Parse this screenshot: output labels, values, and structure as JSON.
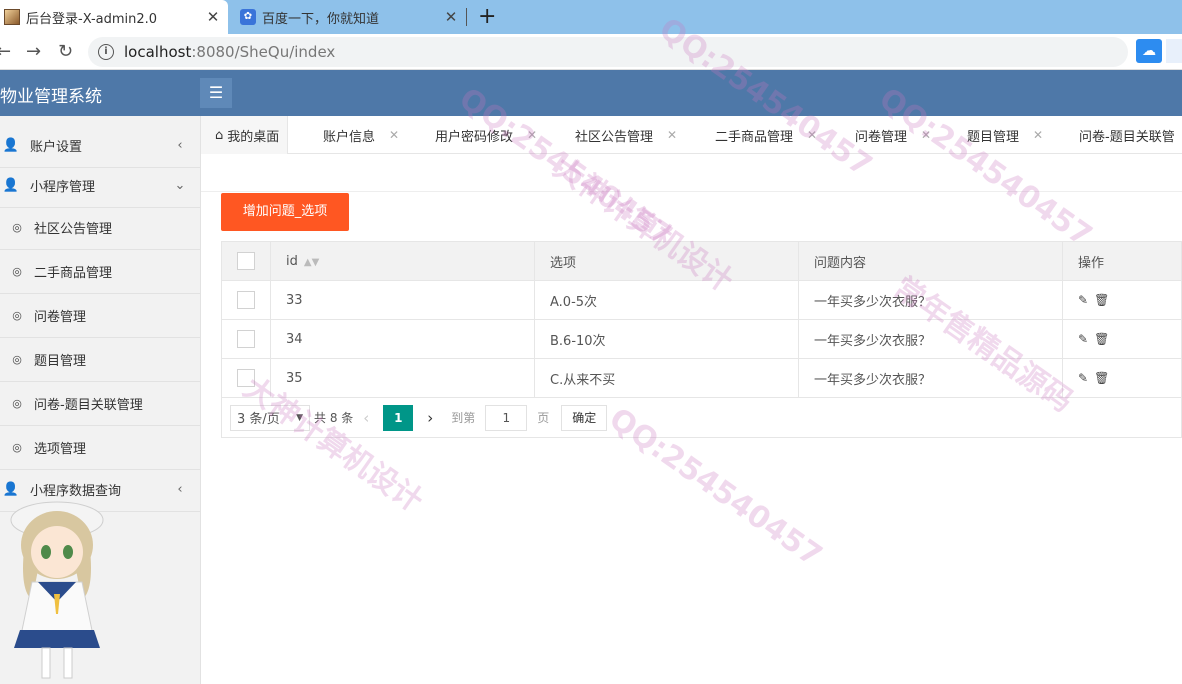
{
  "browser": {
    "tabs": [
      {
        "title": "后台登录-X-admin2.0",
        "active": true
      },
      {
        "title": "百度一下，你就知道",
        "active": false
      }
    ],
    "url_host": "localhost",
    "url_path": ":8080/SheQu/index"
  },
  "app": {
    "title": "物业管理系统",
    "menu_toggle_icon": "menu-icon"
  },
  "sidebar": {
    "items": [
      {
        "label": "账户设置",
        "arrow": "<",
        "type": "top"
      },
      {
        "label": "小程序管理",
        "arrow": "∨",
        "type": "top"
      },
      {
        "label": "社区公告管理",
        "type": "sub"
      },
      {
        "label": "二手商品管理",
        "type": "sub"
      },
      {
        "label": "问卷管理",
        "type": "sub"
      },
      {
        "label": "题目管理",
        "type": "sub"
      },
      {
        "label": "问卷-题目关联管理",
        "type": "sub"
      },
      {
        "label": "选项管理",
        "type": "sub"
      },
      {
        "label": "小程序数据查询",
        "arrow": "<",
        "type": "top"
      }
    ]
  },
  "page_tabs": [
    {
      "label": "我的桌面"
    },
    {
      "label": "账户信息"
    },
    {
      "label": "用户密码修改"
    },
    {
      "label": "社区公告管理"
    },
    {
      "label": "二手商品管理"
    },
    {
      "label": "问卷管理"
    },
    {
      "label": "题目管理"
    },
    {
      "label": "问卷-题目关联管"
    }
  ],
  "main": {
    "add_button": "增加问题_选项",
    "columns": [
      "id",
      "选项",
      "问题内容",
      "操作"
    ],
    "rows": [
      {
        "id": "33",
        "option": "A.0-5次",
        "question": "一年买多少次衣服？"
      },
      {
        "id": "34",
        "option": "B.6-10次",
        "question": "一年买多少次衣服？"
      },
      {
        "id": "35",
        "option": "C.从来不买",
        "question": "一年买多少次衣服？"
      }
    ],
    "pager": {
      "page_size": "3 条/页",
      "total": "共 8 条",
      "current": "1",
      "goto_label": "到第",
      "goto_value": "1",
      "page_label": "页",
      "confirm": "确定"
    }
  },
  "watermarks": [
    "QQ:254540457",
    "大神计算机设计",
    "常年售精品源码"
  ],
  "colors": {
    "header": "#4e78a8",
    "add_button": "#ff5722",
    "pager_current": "#009688"
  }
}
